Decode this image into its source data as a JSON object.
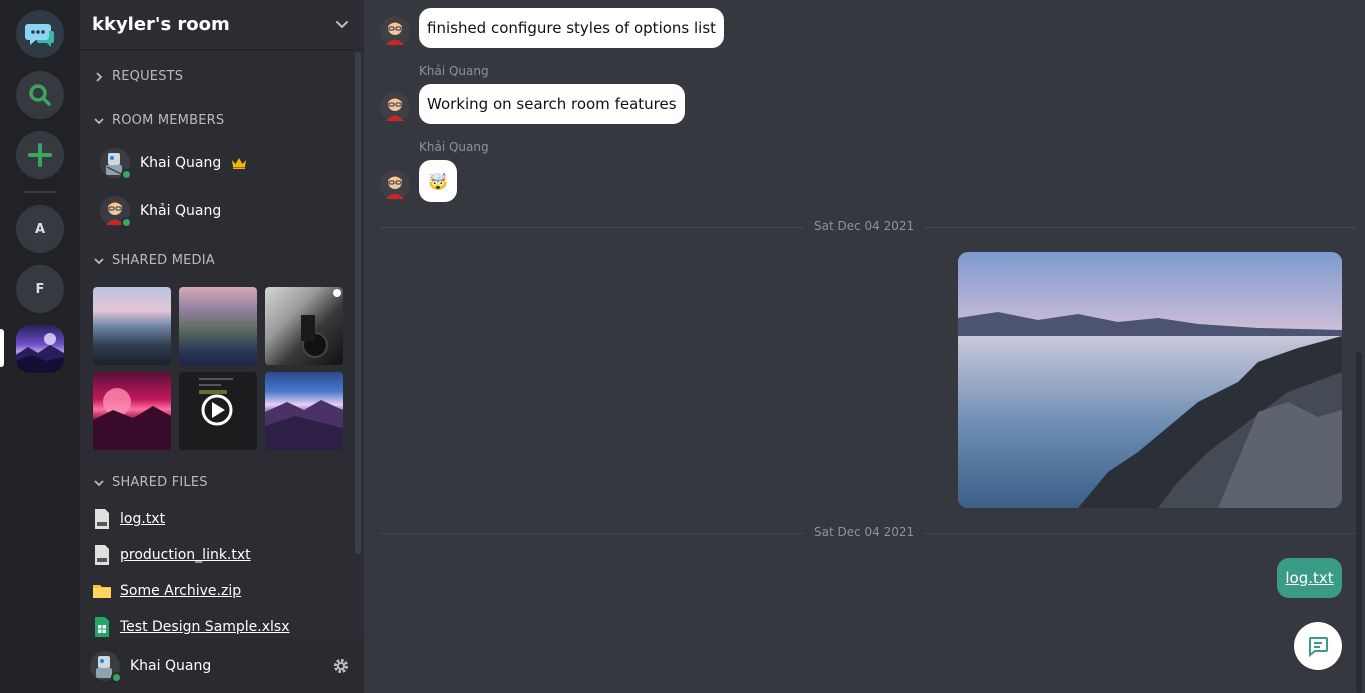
{
  "rail": {
    "servers": [
      {
        "letter": "A"
      },
      {
        "letter": "F"
      }
    ]
  },
  "room": {
    "title": "kkyler's room"
  },
  "sections": {
    "requests": "REQUESTS",
    "members": "ROOM MEMBERS",
    "media": "SHARED MEDIA",
    "files": "SHARED FILES"
  },
  "members": [
    {
      "name": "Khai Quang",
      "owner": true,
      "status": "online"
    },
    {
      "name": "Khải Quang",
      "owner": false,
      "status": "online"
    }
  ],
  "files": [
    {
      "name": "log.txt",
      "icon": "text-file-icon"
    },
    {
      "name": "production_link.txt",
      "icon": "text-file-icon"
    },
    {
      "name": "Some Archive.zip",
      "icon": "folder-icon"
    },
    {
      "name": "Test Design Sample.xlsx",
      "icon": "spreadsheet-icon"
    }
  ],
  "current_user": {
    "name": "Khai Quang"
  },
  "messages": [
    {
      "text": "finished configure styles of options list"
    },
    {
      "sender": "Khải Quang",
      "text": "Working on search room features"
    },
    {
      "sender": "Khải Quang",
      "text": "🤯"
    }
  ],
  "dividers": [
    "Sat Dec 04 2021",
    "Sat Dec 04 2021"
  ],
  "outgoing_file": "log.txt",
  "colors": {
    "rail_bg": "#202225",
    "sidebar_bg": "#2b2d33",
    "chat_bg": "#36383f",
    "accent_green": "#3a9b86",
    "online": "#3ba55d"
  }
}
